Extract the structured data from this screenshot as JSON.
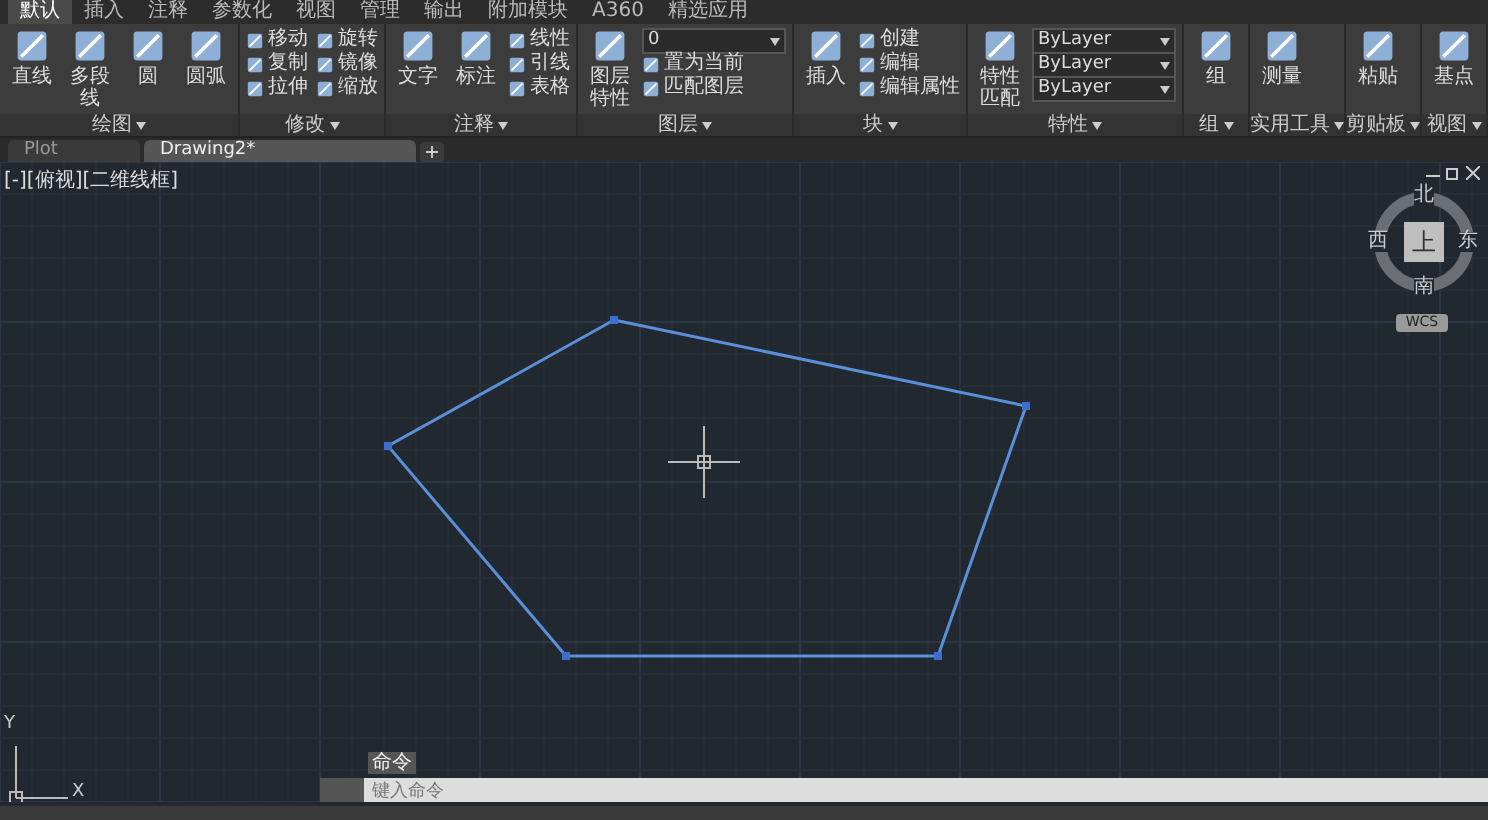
{
  "ribbon_tabs": [
    {
      "label": "默认",
      "selected": true
    },
    {
      "label": "插入",
      "selected": false
    },
    {
      "label": "注释",
      "selected": false
    },
    {
      "label": "参数化",
      "selected": false
    },
    {
      "label": "视图",
      "selected": false
    },
    {
      "label": "管理",
      "selected": false
    },
    {
      "label": "输出",
      "selected": false
    },
    {
      "label": "附加模块",
      "selected": false
    },
    {
      "label": "A360",
      "selected": false
    },
    {
      "label": "精选应用",
      "selected": false
    }
  ],
  "ribbon_panels": [
    {
      "title": "绘图",
      "tools": [
        {
          "kind": "big",
          "label": "直线"
        },
        {
          "kind": "big",
          "label": "多段线"
        },
        {
          "kind": "big",
          "label": "圆"
        },
        {
          "kind": "big",
          "label": "圆弧"
        }
      ]
    },
    {
      "title": "修改",
      "tools": [
        {
          "kind": "small",
          "label": "移动"
        },
        {
          "kind": "small",
          "label": "复制"
        },
        {
          "kind": "small",
          "label": "拉伸"
        },
        {
          "kind": "small",
          "label": "旋转"
        },
        {
          "kind": "small",
          "label": "镜像"
        },
        {
          "kind": "small",
          "label": "缩放"
        }
      ]
    },
    {
      "title": "注释",
      "tools": [
        {
          "kind": "big",
          "label": "文字"
        },
        {
          "kind": "big",
          "label": "标注"
        },
        {
          "kind": "small",
          "label": "线性"
        },
        {
          "kind": "small",
          "label": "引线"
        },
        {
          "kind": "small",
          "label": "表格"
        }
      ]
    },
    {
      "title": "图层",
      "tools": [
        {
          "kind": "big",
          "label": "图层特性"
        },
        {
          "kind": "dropdown",
          "label": "0"
        },
        {
          "kind": "small",
          "label": "置为当前"
        },
        {
          "kind": "small",
          "label": "匹配图层"
        }
      ]
    },
    {
      "title": "块",
      "tools": [
        {
          "kind": "big",
          "label": "插入"
        },
        {
          "kind": "small",
          "label": "创建"
        },
        {
          "kind": "small",
          "label": "编辑"
        },
        {
          "kind": "small",
          "label": "编辑属性"
        }
      ]
    },
    {
      "title": "特性",
      "tools": [
        {
          "kind": "big",
          "label": "特性匹配"
        },
        {
          "kind": "dropdown",
          "label": "ByLayer"
        },
        {
          "kind": "dropdown",
          "label": "ByLayer"
        },
        {
          "kind": "dropdown",
          "label": "ByLayer"
        }
      ]
    },
    {
      "title": "组",
      "tools": [
        {
          "kind": "big",
          "label": "组"
        }
      ]
    },
    {
      "title": "实用工具",
      "tools": [
        {
          "kind": "big",
          "label": "测量"
        }
      ]
    },
    {
      "title": "剪贴板",
      "tools": [
        {
          "kind": "big",
          "label": "粘贴"
        }
      ]
    },
    {
      "title": "视图",
      "tools": [
        {
          "kind": "big",
          "label": "基点"
        }
      ]
    }
  ],
  "file_tabs": [
    {
      "label": "Plot",
      "selected": false
    },
    {
      "label": "Drawing2*",
      "selected": true
    }
  ],
  "viewport_label": "[-][俯视][二维线框]",
  "viewcube": {
    "top": "上",
    "north": "北",
    "south": "南",
    "east": "东",
    "west": "西",
    "wcs": "WCS"
  },
  "ucs": {
    "x": "X",
    "y": "Y"
  },
  "command_line": {
    "tooltip": "命令",
    "placeholder": "键入命令"
  }
}
